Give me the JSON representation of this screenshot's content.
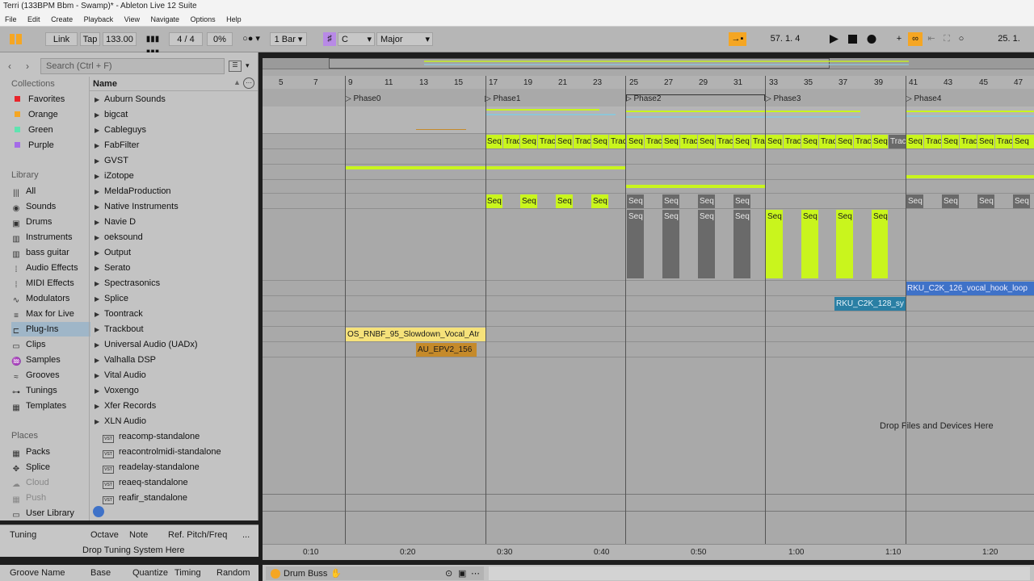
{
  "window": {
    "title": "Terri (133BPM Bbm - Swamp)* - Ableton Live 12 Suite"
  },
  "menu": [
    "File",
    "Edit",
    "Create",
    "Playback",
    "View",
    "Navigate",
    "Options",
    "Help"
  ],
  "transport": {
    "link": "Link",
    "tap": "Tap",
    "tempo": "133.00",
    "sig_num": "4",
    "sig_slash": "/",
    "sig_den": "4",
    "groove_amt": "0%",
    "quantize": "1 Bar",
    "key": "C",
    "scale": "Major",
    "position": [
      "57.",
      "1.",
      "4"
    ],
    "loop_pos": [
      "25.",
      "1."
    ]
  },
  "browser": {
    "search_placeholder": "Search (Ctrl + F)",
    "name_header": "Name",
    "collections_title": "Collections",
    "collections": [
      {
        "label": "Favorites",
        "color": "#e8242a"
      },
      {
        "label": "Orange",
        "color": "#f5a623"
      },
      {
        "label": "Green",
        "color": "#5fe3b0"
      },
      {
        "label": "Purple",
        "color": "#a46be8"
      }
    ],
    "library_title": "Library",
    "library": [
      {
        "label": "All",
        "icon": "all-icon"
      },
      {
        "label": "Sounds",
        "icon": "sounds-icon"
      },
      {
        "label": "Drums",
        "icon": "drums-icon"
      },
      {
        "label": "Instruments",
        "icon": "instruments-icon"
      },
      {
        "label": "bass guitar",
        "icon": "instruments-icon"
      },
      {
        "label": "Audio Effects",
        "icon": "audio-effects-icon"
      },
      {
        "label": "MIDI Effects",
        "icon": "midi-effects-icon"
      },
      {
        "label": "Modulators",
        "icon": "modulators-icon"
      },
      {
        "label": "Max for Live",
        "icon": "max-icon"
      },
      {
        "label": "Plug-Ins",
        "icon": "plugins-icon"
      },
      {
        "label": "Clips",
        "icon": "clips-icon"
      },
      {
        "label": "Samples",
        "icon": "samples-icon"
      },
      {
        "label": "Grooves",
        "icon": "grooves-icon"
      },
      {
        "label": "Tunings",
        "icon": "tunings-icon"
      },
      {
        "label": "Templates",
        "icon": "templates-icon"
      }
    ],
    "places_title": "Places",
    "places": [
      {
        "label": "Packs"
      },
      {
        "label": "Splice"
      },
      {
        "label": "Cloud"
      },
      {
        "label": "Push"
      },
      {
        "label": "User Library"
      }
    ],
    "folders": [
      "Auburn Sounds",
      "bigcat",
      "Cableguys",
      "FabFilter",
      "GVST",
      "iZotope",
      "MeldaProduction",
      "Native Instruments",
      "Navie D",
      "oeksound",
      "Output",
      "Serato",
      "Spectrasonics",
      "Splice",
      "Toontrack",
      "Trackbout",
      "Universal Audio (UADx)",
      "Valhalla DSP",
      "Vital Audio",
      "Voxengo",
      "Xfer Records",
      "XLN Audio"
    ],
    "plugins": [
      "reacomp-standalone",
      "reacontrolmidi-standalone",
      "readelay-standalone",
      "reaeq-standalone",
      "reafir_standalone"
    ],
    "vst_badge": "VST"
  },
  "tuning": {
    "headers": [
      "Tuning",
      "Octave",
      "Note",
      "Ref. Pitch/Freq"
    ],
    "drop": "Drop Tuning System Here",
    "more": "..."
  },
  "groove": {
    "headers": [
      "Groove Name",
      "Base",
      "Quantize",
      "Timing",
      "Random"
    ]
  },
  "clip_view": {
    "track": "Drum Buss"
  },
  "arrangement": {
    "bars": [
      "5",
      "7",
      "9",
      "11",
      "13",
      "15",
      "17",
      "19",
      "21",
      "23",
      "25",
      "27",
      "29",
      "31",
      "33",
      "35",
      "37",
      "39",
      "41",
      "43",
      "45",
      "47"
    ],
    "locators": [
      "Phase0",
      "Phase1",
      "Phase2",
      "Phase3",
      "Phase4"
    ],
    "times": [
      "0:10",
      "0:20",
      "0:30",
      "0:40",
      "0:50",
      "1:00",
      "1:10",
      "1:20"
    ],
    "drop_hint": "Drop Files and Devices Here",
    "clips": {
      "seq": "Seq",
      "track": "Track",
      "vocal_hook": "RKU_C2K_126_vocal_hook_loop",
      "syn": "RKU_C2K_128_sy",
      "slowdown": "OS_RNBF_95_Slowdown_Vocal_Atr",
      "epv": "AU_EPV2_156"
    }
  },
  "colors": {
    "lime": "#c9f51d",
    "orange": "#f5a623",
    "blue": "#3f72c8",
    "teal": "#2a7fa4",
    "yellow": "#f6e27a"
  }
}
